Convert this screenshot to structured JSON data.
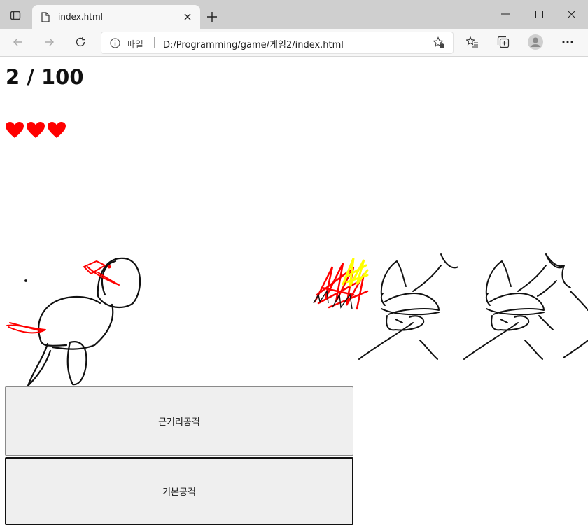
{
  "browser": {
    "tab_title": "index.html",
    "address_scheme": "파일",
    "address_url": "D:/Programming/game/게임2/index.html"
  },
  "game": {
    "score_text": "2 / 100",
    "hearts_count": 3,
    "heart_color": "#ff0000",
    "melee_attack_label": "근거리공격",
    "basic_attack_label": "기본공격"
  }
}
